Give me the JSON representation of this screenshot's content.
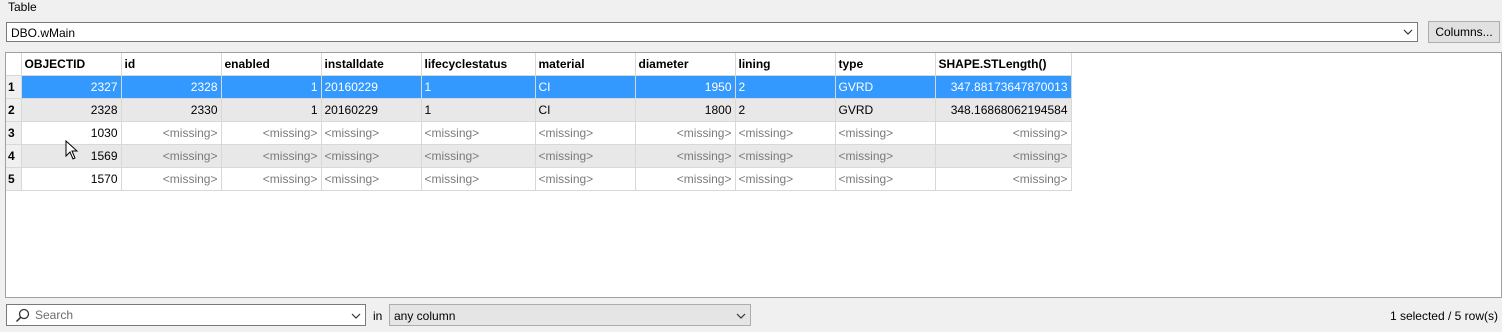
{
  "group_label": "Table",
  "table_selector": {
    "value": "DBO.wMain"
  },
  "columns_button": "Columns...",
  "grid": {
    "headers": [
      "OBJECTID",
      "id",
      "enabled",
      "installdate",
      "lifecyclestatus",
      "material",
      "diameter",
      "lining",
      "type",
      "SHAPE.STLength()"
    ],
    "rows": [
      {
        "num": "1",
        "selected": true,
        "cells": [
          "2327",
          "2328",
          "1",
          "20160229",
          "1",
          "CI",
          "1950",
          "2",
          "GVRD",
          "347.88173647870013"
        ]
      },
      {
        "num": "2",
        "selected": false,
        "cells": [
          "2328",
          "2330",
          "1",
          "20160229",
          "1",
          "CI",
          "1800",
          "2",
          "GVRD",
          "348.16868062194584"
        ]
      },
      {
        "num": "3",
        "selected": false,
        "cells": [
          "1030",
          "<missing>",
          "<missing>",
          "<missing>",
          "<missing>",
          "<missing>",
          "<missing>",
          "<missing>",
          "<missing>",
          "<missing>"
        ]
      },
      {
        "num": "4",
        "selected": false,
        "cells": [
          "1569",
          "<missing>",
          "<missing>",
          "<missing>",
          "<missing>",
          "<missing>",
          "<missing>",
          "<missing>",
          "<missing>",
          "<missing>"
        ]
      },
      {
        "num": "5",
        "selected": false,
        "cells": [
          "1570",
          "<missing>",
          "<missing>",
          "<missing>",
          "<missing>",
          "<missing>",
          "<missing>",
          "<missing>",
          "<missing>",
          "<missing>"
        ]
      }
    ],
    "alignment": [
      "right",
      "right",
      "right",
      "left",
      "left",
      "left",
      "right",
      "left",
      "left",
      "right"
    ]
  },
  "search": {
    "placeholder": "Search",
    "value": ""
  },
  "in_label": "in",
  "column_filter": {
    "value": "any column"
  },
  "status": "1 selected / 5 row(s)",
  "colors": {
    "selection": "#3399ff",
    "alt_row": "#e8e8e8",
    "missing_text": "#7a7a7a"
  },
  "icons": {
    "search": "search-icon",
    "dropdown": "chevron-down-icon",
    "cursor": "mouse-pointer-icon"
  }
}
